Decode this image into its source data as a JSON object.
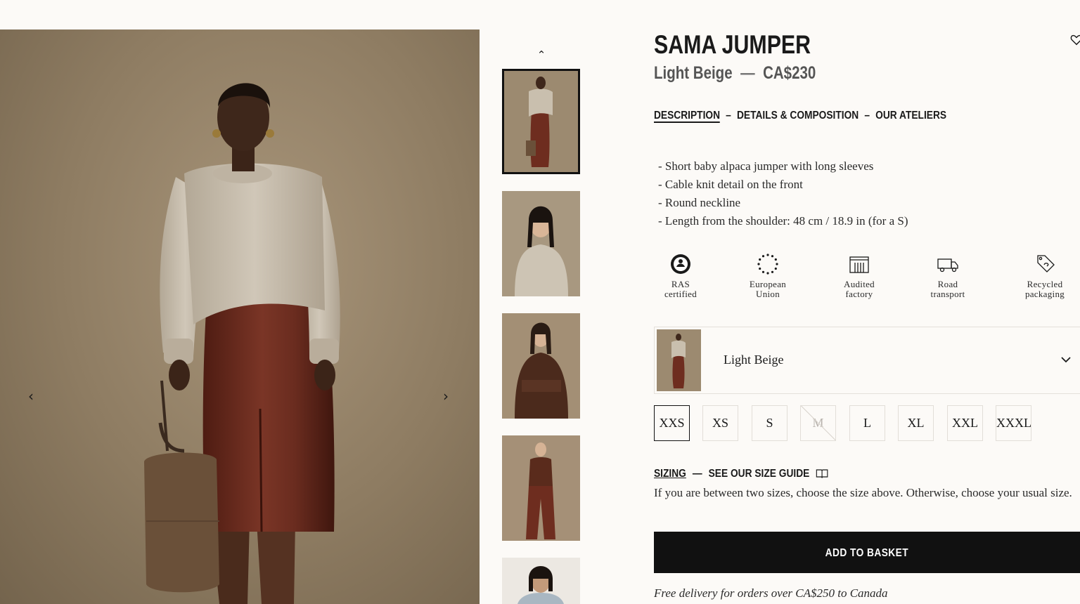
{
  "gallery": {
    "prev_icon": "chevron-left-icon",
    "next_icon": "chevron-right-icon",
    "thumbs_up_icon": "chevron-up-icon",
    "thumbnail_count": 5,
    "selected_thumbnail": 1
  },
  "product": {
    "title": "SAMA JUMPER",
    "color": "Light Beige",
    "dash": "—",
    "price": "CA$230",
    "wishlist_icon": "heart-icon"
  },
  "tabs": [
    {
      "label": "DESCRIPTION",
      "active": true
    },
    {
      "label": "DETAILS & COMPOSITION",
      "active": false
    },
    {
      "label": "OUR ATELIERS",
      "active": false
    }
  ],
  "tab_separator": "–",
  "description": [
    "- Short baby alpaca jumper with long sleeves",
    "- Cable knit detail on the front",
    "- Round neckline",
    "- Length from the shoulder: 48 cm / 18.9 in (for a S)"
  ],
  "badges": [
    {
      "line1": "RAS",
      "line2": "certified",
      "icon": "ras-certified-icon"
    },
    {
      "line1": "European",
      "line2": "Union",
      "icon": "eu-stars-icon"
    },
    {
      "line1": "Audited",
      "line2": "factory",
      "icon": "factory-icon"
    },
    {
      "line1": "Road",
      "line2": "transport",
      "icon": "truck-icon"
    },
    {
      "line1": "Recycled",
      "line2": "packaging",
      "icon": "recycled-tag-icon"
    }
  ],
  "color_selector": {
    "selected": "Light Beige",
    "icon": "chevron-down-icon"
  },
  "sizes": [
    {
      "label": "XXS",
      "selected": true,
      "available": true
    },
    {
      "label": "XS",
      "selected": false,
      "available": true
    },
    {
      "label": "S",
      "selected": false,
      "available": true
    },
    {
      "label": "M",
      "selected": false,
      "available": false
    },
    {
      "label": "L",
      "selected": false,
      "available": true
    },
    {
      "label": "XL",
      "selected": false,
      "available": true
    },
    {
      "label": "XXL",
      "selected": false,
      "available": true
    },
    {
      "label": "XXXL",
      "selected": false,
      "available": true
    }
  ],
  "sizing": {
    "label": "SIZING",
    "separator": "—",
    "guide_link": "SEE OUR SIZE GUIDE",
    "guide_icon": "book-icon",
    "help": "If you are between two sizes, choose the size above. Otherwise, choose your usual size."
  },
  "basket": {
    "button_label": "ADD TO BASKET",
    "delivery_note": "Free delivery for orders over CA$250 to Canada"
  },
  "colors": {
    "background": "#fcfaf7",
    "button": "#111111",
    "sweater": "#c9bfae",
    "skirt": "#6e2d1f"
  }
}
